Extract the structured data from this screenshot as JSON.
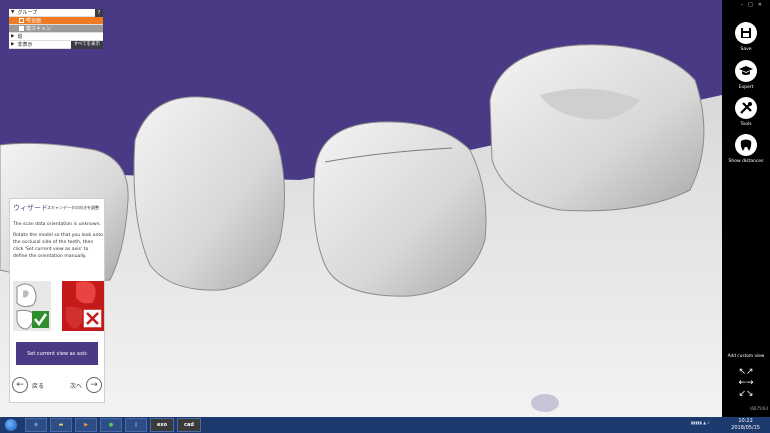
{
  "groups": {
    "header": "グループ",
    "help": "?",
    "items": [
      {
        "label": "咬合面"
      },
      {
        "label": "模スキャン"
      }
    ],
    "section_label": "追",
    "hidden_label": "非表示",
    "show_all": "すべてを表示"
  },
  "wizard": {
    "title": "ウィザード",
    "subtitle": "スキャンデータの向きを調整",
    "text1": "The scan data orientation is unknown.",
    "text2": "Rotate the model so that you look onto the occlusal side of the teeth, then click 'Set current view as axis' to define the orientation manually.",
    "button": "Set current view as axis",
    "back": "戻る",
    "next": "次へ"
  },
  "sidebar": {
    "buttons": [
      {
        "label": "Save",
        "icon": "save-icon"
      },
      {
        "label": "Expert",
        "icon": "graduation-cap-icon"
      },
      {
        "label": "Tools",
        "icon": "tools-icon"
      },
      {
        "label": "Show distances",
        "icon": "tooth-icon"
      }
    ],
    "custom_view": "Add custom view",
    "build": "\\6675/64"
  },
  "taskbar": {
    "apps": [
      {
        "label": "exo"
      },
      {
        "label": "cad"
      }
    ],
    "time": "10:22",
    "date": "2018/05/15"
  },
  "colors": {
    "background": "#4a3a86",
    "accent_orange": "#f07a22",
    "sidebar": "#000000",
    "taskbar": "#1c3a6e"
  }
}
